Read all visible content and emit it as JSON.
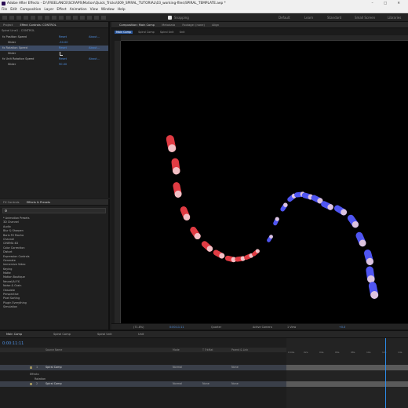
{
  "window": {
    "title": "Adobe After Effects - D:\\FREELANCE\\SCRAPS\\Motion\\Quick_Tricks\\009_SPIRAL_TUTORIAL\\03_working-files\\SPIRAL_TEMPLATE.aep *"
  },
  "menu": [
    "File",
    "Edit",
    "Composition",
    "Layer",
    "Effect",
    "Animation",
    "View",
    "Window",
    "Help"
  ],
  "toolbar": {
    "snapping": "Snapping",
    "workspaces": [
      "Default",
      "Learn",
      "Standard",
      "Small Screen",
      "Libraries"
    ]
  },
  "left_panel": {
    "tabs": [
      "Project",
      "Effect Controls: CONTROL"
    ],
    "header": "Spiral Line1 - CONTROL",
    "rows": [
      {
        "label": "fx  Position Speed",
        "val": "Reset",
        "about": "About..."
      },
      {
        "label": "Slider",
        "val": "-30.00",
        "about": ""
      },
      {
        "label": "fx  Rotation Speed",
        "val": "Reset",
        "about": "About..."
      },
      {
        "label": "Slider",
        "val": "",
        "about": ""
      },
      {
        "label": "fx  Unit Rotation Speed",
        "val": "Reset",
        "about": "About..."
      },
      {
        "label": "Slider",
        "val": "90.00",
        "about": ""
      }
    ]
  },
  "effects_panel": {
    "tabs": [
      "FX Controls",
      "Effects & Presets"
    ],
    "items": [
      "* Animation Presets",
      "3D Channel",
      "Audio",
      "Blur & Sharpen",
      "Boris FX Mocha",
      "Channel",
      "CINEMA 4D",
      "Color Correction",
      "Distort",
      "Expression Controls",
      "Generate",
      "Immersive Video",
      "Keying",
      "Matte",
      "Motion Boutique",
      "Neural/AI FX",
      "Noise & Grain",
      "Obsolete",
      "Perspective",
      "Pixel Sorting",
      "Plugin Everything",
      "Simulation"
    ]
  },
  "composition": {
    "tabs": [
      "Composition: Main Comp",
      "Metadata",
      "Footage: (none)",
      "Align"
    ],
    "subtabs": [
      "Main Comp",
      "Spiral Comp",
      "Spiral Unit",
      "Unit"
    ],
    "viewer_bar": {
      "zoom": "(71.8%)",
      "time": "0:00:11:11",
      "resolution": "Quarter",
      "camera": "Active Camera",
      "views": "1 View",
      "exposure": "+0.0"
    }
  },
  "timeline": {
    "tabs": [
      "Main Comp",
      "Spiral Comp",
      "Spiral Unit",
      "Unit"
    ],
    "timecode": "0:00:11:11",
    "col_headers": [
      "Source Name",
      "Mode",
      "T TrkMat",
      "Parent & Link"
    ],
    "layers": [
      {
        "num": "1",
        "name": "Spiral Comp",
        "mode": "Normal",
        "trk": "",
        "parent": "None",
        "selected": true
      },
      {
        "num": "",
        "name": "Effects",
        "mode": "",
        "trk": "",
        "parent": "",
        "selected": false
      },
      {
        "num": "",
        "name": "Rotation",
        "mode": "",
        "trk": "",
        "parent": "",
        "selected": false
      },
      {
        "num": "2",
        "name": "Spiral Comp",
        "mode": "Normal",
        "trk": "None",
        "parent": "None",
        "selected": false
      }
    ],
    "ruler": [
      "0:00s",
      "02s",
      "04s",
      "06s",
      "08s",
      "10s",
      "12s",
      "14s"
    ]
  },
  "colors": {
    "accent": "#2d8ceb",
    "red_unit": "#e03b43",
    "blue_unit": "#4f55f2"
  }
}
